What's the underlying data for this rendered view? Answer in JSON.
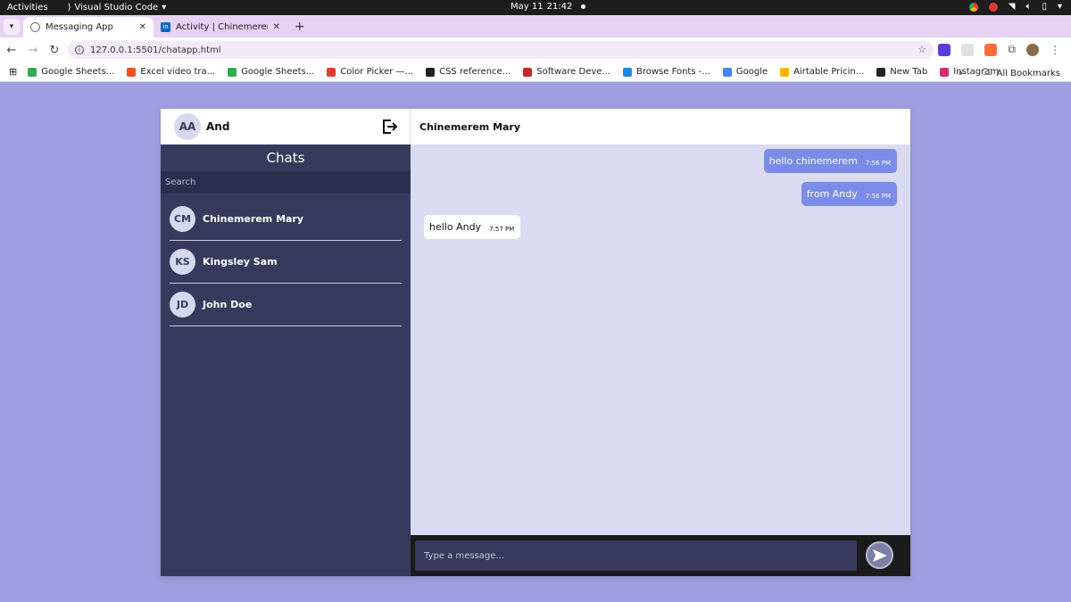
{
  "system_bar": {
    "activities": "Activities",
    "app_name": "Visual Studio Code",
    "date": "May 11",
    "time": "21:42"
  },
  "browser": {
    "tabs": [
      {
        "title": "Messaging App",
        "active": true
      },
      {
        "title": "Activity | Chinemerem U...",
        "active": false
      }
    ],
    "url": "127.0.0.1:5501/chatapp.html",
    "bookmarks": [
      {
        "label": "Google Sheets...",
        "color": "#34a853"
      },
      {
        "label": "Excel video tra...",
        "color": "#f25022"
      },
      {
        "label": "Google Sheets...",
        "color": "#34a853"
      },
      {
        "label": "Color Picker —...",
        "color": "#e53935"
      },
      {
        "label": "CSS reference...",
        "color": "#222222"
      },
      {
        "label": "Software Deve...",
        "color": "#c62828"
      },
      {
        "label": "Browse Fonts -...",
        "color": "#1e88e5"
      },
      {
        "label": "Google",
        "color": "#4285f4"
      },
      {
        "label": "Airtable Pricin...",
        "color": "#fcb400"
      },
      {
        "label": "New Tab",
        "color": "#222222"
      },
      {
        "label": "Instagram",
        "color": "#d62976"
      }
    ],
    "all_bookmarks": "All Bookmarks"
  },
  "sidebar": {
    "user_initials": "AA",
    "user_name": "And",
    "title": "Chats",
    "search_placeholder": "Search",
    "chats": [
      {
        "initials": "CM",
        "name": "Chinemerem Mary"
      },
      {
        "initials": "KS",
        "name": "Kingsley Sam"
      },
      {
        "initials": "JD",
        "name": "John Doe"
      }
    ]
  },
  "conversation": {
    "contact_name": "Chinemerem Mary",
    "messages": [
      {
        "direction": "out",
        "text": "hello chinemerem",
        "time": "7:56 PM"
      },
      {
        "direction": "out",
        "text": "from Andy",
        "time": "7:56 PM"
      },
      {
        "direction": "in",
        "text": "hello Andy",
        "time": "7:57 PM"
      }
    ],
    "input_placeholder": "Type a message..."
  },
  "colors": {
    "page_bg": "#a09ee0",
    "sidebar_bg": "#373a5c",
    "chat_bg": "#dadaf3",
    "outgoing_bubble": "#7b8ce6"
  }
}
